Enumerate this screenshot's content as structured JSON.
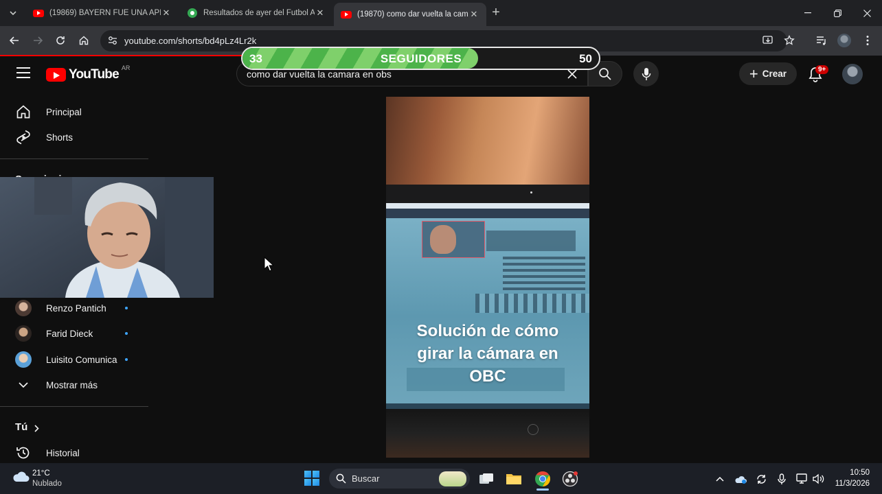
{
  "browser": {
    "tabs": [
      {
        "title": "(19869) BAYERN FUE UNA APLA",
        "favicon": "youtube-icon",
        "active": false
      },
      {
        "title": "Resultados de ayer del Futbol A",
        "favicon": "globe-icon",
        "active": false
      },
      {
        "title": "(19870) como dar vuelta la cam",
        "favicon": "youtube-icon",
        "active": true
      }
    ],
    "url": "youtube.com/shorts/bd4pLz4Lr2k"
  },
  "followers_overlay": {
    "current": "33",
    "label": "SEGUIDORES",
    "goal": "50",
    "progress": 0.66
  },
  "youtube": {
    "logo_text": "YouTube",
    "country_code": "AR",
    "search_query": "como dar vuelta la camara en obs",
    "create_label": "Crear",
    "notifications_badge": "9+",
    "sidebar": {
      "main": [
        {
          "label": "Principal",
          "icon": "home-icon"
        },
        {
          "label": "Shorts",
          "icon": "shorts-icon"
        }
      ],
      "subscriptions_title": "Suscripciones",
      "subscriptions": [
        {
          "label": "Renzo Pantich",
          "icon": "channel-avatar"
        },
        {
          "label": "Farid Dieck",
          "icon": "channel-avatar"
        },
        {
          "label": "Luisito Comunica",
          "icon": "channel-avatar"
        }
      ],
      "show_more": "Mostrar más",
      "you_title": "Tú",
      "history": "Historial"
    },
    "short": {
      "caption": "Solución de cómo girar la cámara en OBC"
    }
  },
  "taskbar": {
    "weather_temp": "21°C",
    "weather_desc": "Nublado",
    "search_label": "Buscar",
    "time": "10:50",
    "date": "11/3/2026"
  },
  "colors": {
    "accent_red": "#ff0000",
    "progress_green": "#4cb34a",
    "link_blue": "#3ea6ff"
  }
}
